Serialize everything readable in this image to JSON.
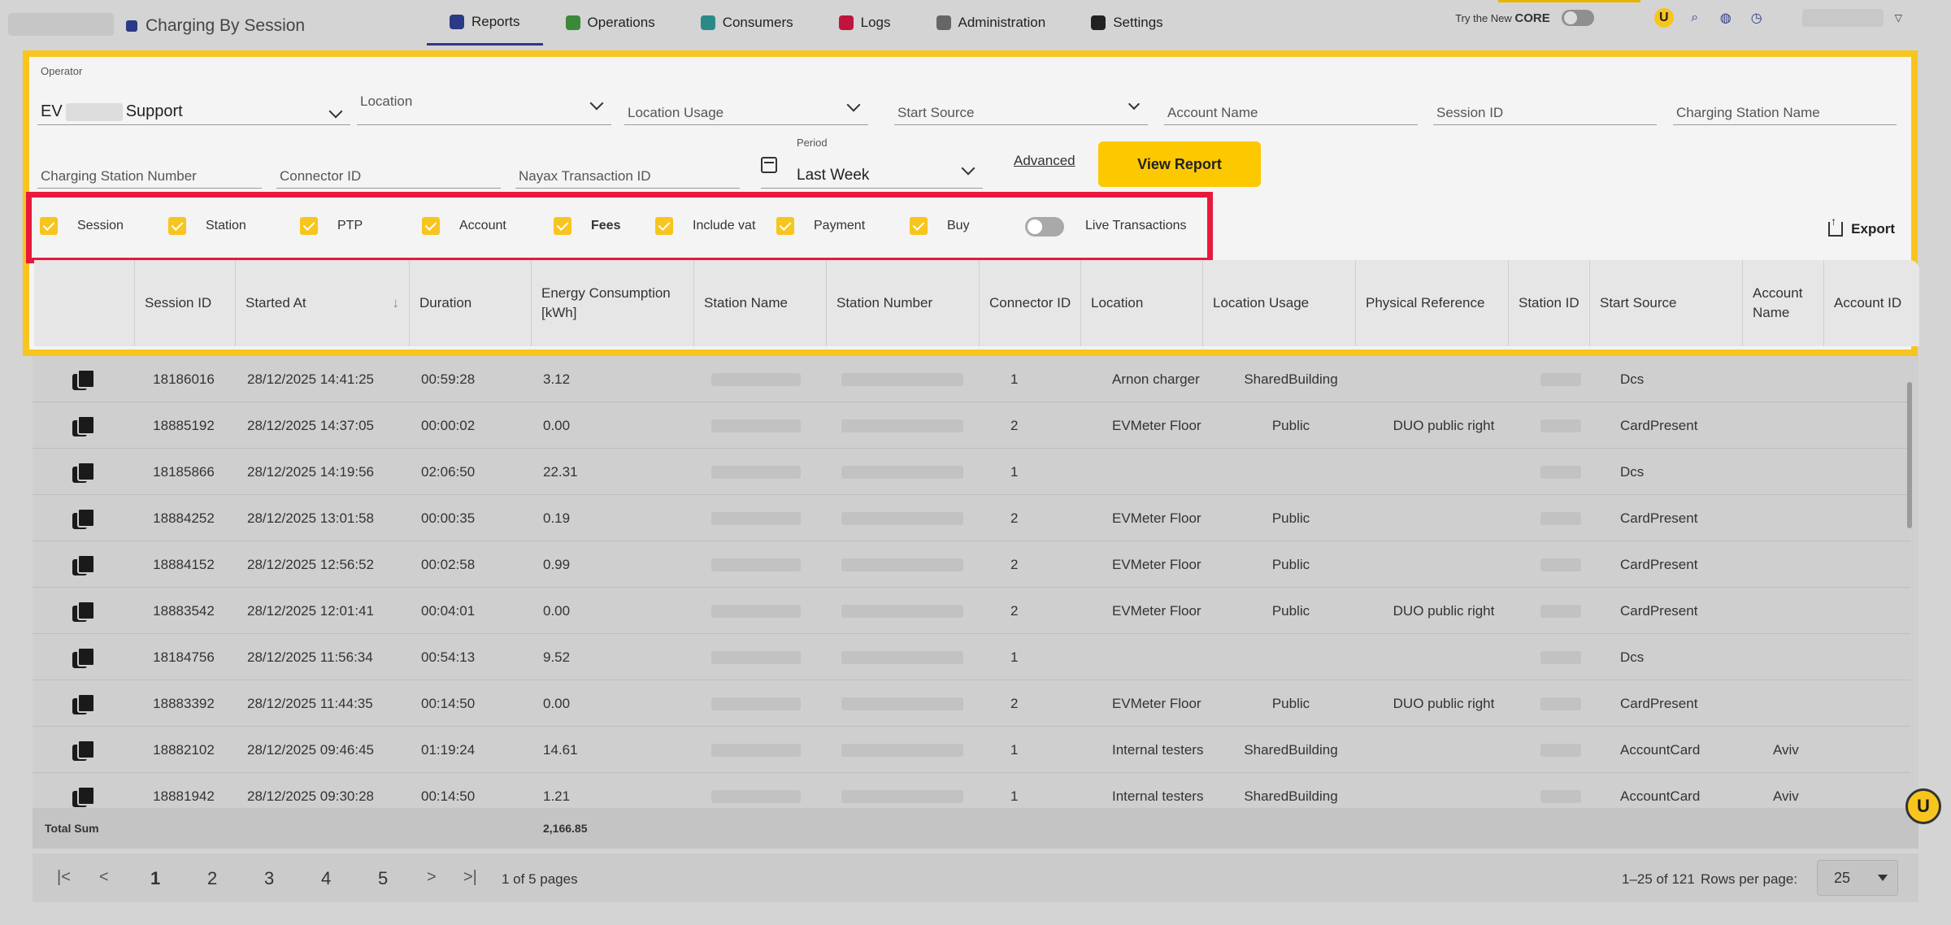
{
  "app": {
    "title": "Charging By Session"
  },
  "nav": [
    {
      "label": "Reports",
      "color": "#2b3a86"
    },
    {
      "label": "Operations",
      "color": "#3a8a3a"
    },
    {
      "label": "Consumers",
      "color": "#2a8a8a"
    },
    {
      "label": "Logs",
      "color": "#c0143c"
    },
    {
      "label": "Administration",
      "color": "#666666"
    },
    {
      "label": "Settings",
      "color": "#222222"
    }
  ],
  "topright": {
    "try_prefix": "Try the New",
    "try_brand": "CORE"
  },
  "filters": {
    "operator_label": "Operator",
    "operator_value_prefix": "EV",
    "operator_value_suffix": "Support",
    "location": "Location",
    "location_usage": "Location Usage",
    "start_source": "Start Source",
    "account_name": "Account Name",
    "session_id": "Session ID",
    "charging_station_name": "Charging Station Name",
    "charging_station_number": "Charging Station Number",
    "connector_id": "Connector ID",
    "nayax_transaction_id": "Nayax Transaction ID",
    "period_label": "Period",
    "period_value": "Last Week",
    "advanced": "Advanced",
    "view_report": "View Report"
  },
  "checkboxes": [
    {
      "label": "Session"
    },
    {
      "label": "Station"
    },
    {
      "label": "PTP"
    },
    {
      "label": "Account"
    },
    {
      "label": "Fees"
    },
    {
      "label": "Include vat"
    },
    {
      "label": "Payment"
    },
    {
      "label": "Buy"
    }
  ],
  "live_transactions": "Live Transactions",
  "export": "Export",
  "columns": [
    "",
    "Session ID",
    "Started At",
    "Duration",
    "Energy Consumption [kWh]",
    "Station Name",
    "Station Number",
    "Connector ID",
    "Location",
    "Location Usage",
    "Physical Reference",
    "Station ID",
    "Start Source",
    "Account Name",
    "Account ID"
  ],
  "rows": [
    {
      "session_id": "18186016",
      "started_at": "28/12/2025 14:41:25",
      "duration": "00:59:28",
      "energy": "3.12",
      "connector": "1",
      "location": "Arnon charger",
      "usage": "SharedBuilding",
      "physical_ref": "",
      "start_source": "Dcs",
      "account_name": ""
    },
    {
      "session_id": "18885192",
      "started_at": "28/12/2025 14:37:05",
      "duration": "00:00:02",
      "energy": "0.00",
      "connector": "2",
      "location": "EVMeter Floor",
      "usage": "Public",
      "physical_ref": "DUO public right",
      "start_source": "CardPresent",
      "account_name": ""
    },
    {
      "session_id": "18185866",
      "started_at": "28/12/2025 14:19:56",
      "duration": "02:06:50",
      "energy": "22.31",
      "connector": "1",
      "location": "",
      "usage": "",
      "physical_ref": "",
      "start_source": "Dcs",
      "account_name": ""
    },
    {
      "session_id": "18884252",
      "started_at": "28/12/2025 13:01:58",
      "duration": "00:00:35",
      "energy": "0.19",
      "connector": "2",
      "location": "EVMeter Floor",
      "usage": "Public",
      "physical_ref": "",
      "start_source": "CardPresent",
      "account_name": ""
    },
    {
      "session_id": "18884152",
      "started_at": "28/12/2025 12:56:52",
      "duration": "00:02:58",
      "energy": "0.99",
      "connector": "2",
      "location": "EVMeter Floor",
      "usage": "Public",
      "physical_ref": "",
      "start_source": "CardPresent",
      "account_name": ""
    },
    {
      "session_id": "18883542",
      "started_at": "28/12/2025 12:01:41",
      "duration": "00:04:01",
      "energy": "0.00",
      "connector": "2",
      "location": "EVMeter Floor",
      "usage": "Public",
      "physical_ref": "DUO public right",
      "start_source": "CardPresent",
      "account_name": ""
    },
    {
      "session_id": "18184756",
      "started_at": "28/12/2025 11:56:34",
      "duration": "00:54:13",
      "energy": "9.52",
      "connector": "1",
      "location": "",
      "usage": "",
      "physical_ref": "",
      "start_source": "Dcs",
      "account_name": ""
    },
    {
      "session_id": "18883392",
      "started_at": "28/12/2025 11:44:35",
      "duration": "00:14:50",
      "energy": "0.00",
      "connector": "2",
      "location": "EVMeter Floor",
      "usage": "Public",
      "physical_ref": "DUO public right",
      "start_source": "CardPresent",
      "account_name": ""
    },
    {
      "session_id": "18882102",
      "started_at": "28/12/2025 09:46:45",
      "duration": "01:19:24",
      "energy": "14.61",
      "connector": "1",
      "location": "Internal testers",
      "usage": "SharedBuilding",
      "physical_ref": "",
      "start_source": "AccountCard",
      "account_name": "Aviv"
    },
    {
      "session_id": "18881942",
      "started_at": "28/12/2025 09:30:28",
      "duration": "00:14:50",
      "energy": "1.21",
      "connector": "1",
      "location": "Internal testers",
      "usage": "SharedBuilding",
      "physical_ref": "",
      "start_source": "AccountCard",
      "account_name": "Aviv"
    }
  ],
  "totals": {
    "label": "Total Sum",
    "energy": "2,166.85"
  },
  "pagination": {
    "pages": [
      "1",
      "2",
      "3",
      "4",
      "5"
    ],
    "first": "|<",
    "prev": "<",
    "next": ">",
    "last": ">|",
    "page_info": "1 of 5 pages",
    "range": "1–25 of 121",
    "rows_per_page_label": "Rows per page:",
    "rows_per_page": "25"
  },
  "colors": {
    "accent": "#f7c51e",
    "highlight": "#e8193c",
    "nav_active": "#2b3a86"
  }
}
